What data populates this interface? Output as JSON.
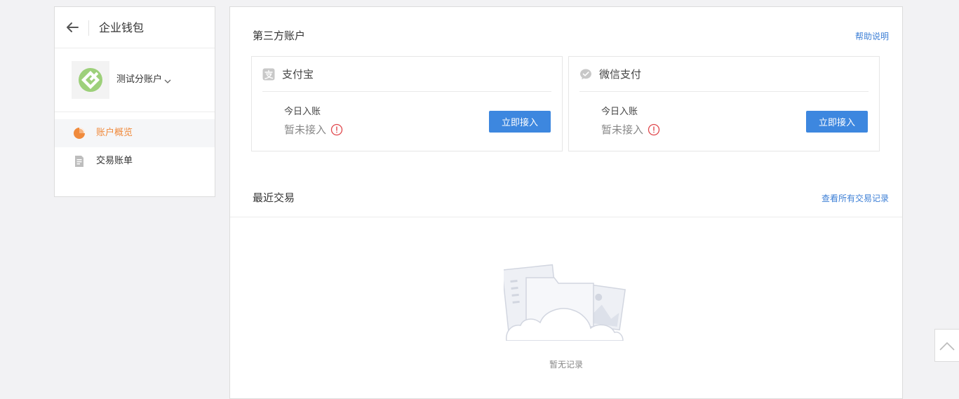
{
  "sidebar": {
    "title": "企业钱包",
    "account": {
      "name": "测试分账户"
    },
    "menu": [
      {
        "label": "账户概览",
        "active": true,
        "icon": "pie-chart-icon"
      },
      {
        "label": "交易账单",
        "active": false,
        "icon": "document-icon"
      }
    ]
  },
  "main": {
    "third_party": {
      "title": "第三方账户",
      "help_link": "帮助说明",
      "cards": [
        {
          "name": "支付宝",
          "icon": "alipay-icon",
          "today_label": "今日入账",
          "status": "暂未接入",
          "button": "立即接入"
        },
        {
          "name": "微信支付",
          "icon": "wechat-pay-icon",
          "today_label": "今日入账",
          "status": "暂未接入",
          "button": "立即接入"
        }
      ]
    },
    "recent": {
      "title": "最近交易",
      "view_all_link": "查看所有交易记录",
      "empty_text": "暂无记录"
    }
  },
  "colors": {
    "accent_orange": "#f08a3c",
    "link_blue": "#3d7fd6",
    "button_blue": "#3d87df",
    "alert_red": "#e0474c"
  }
}
